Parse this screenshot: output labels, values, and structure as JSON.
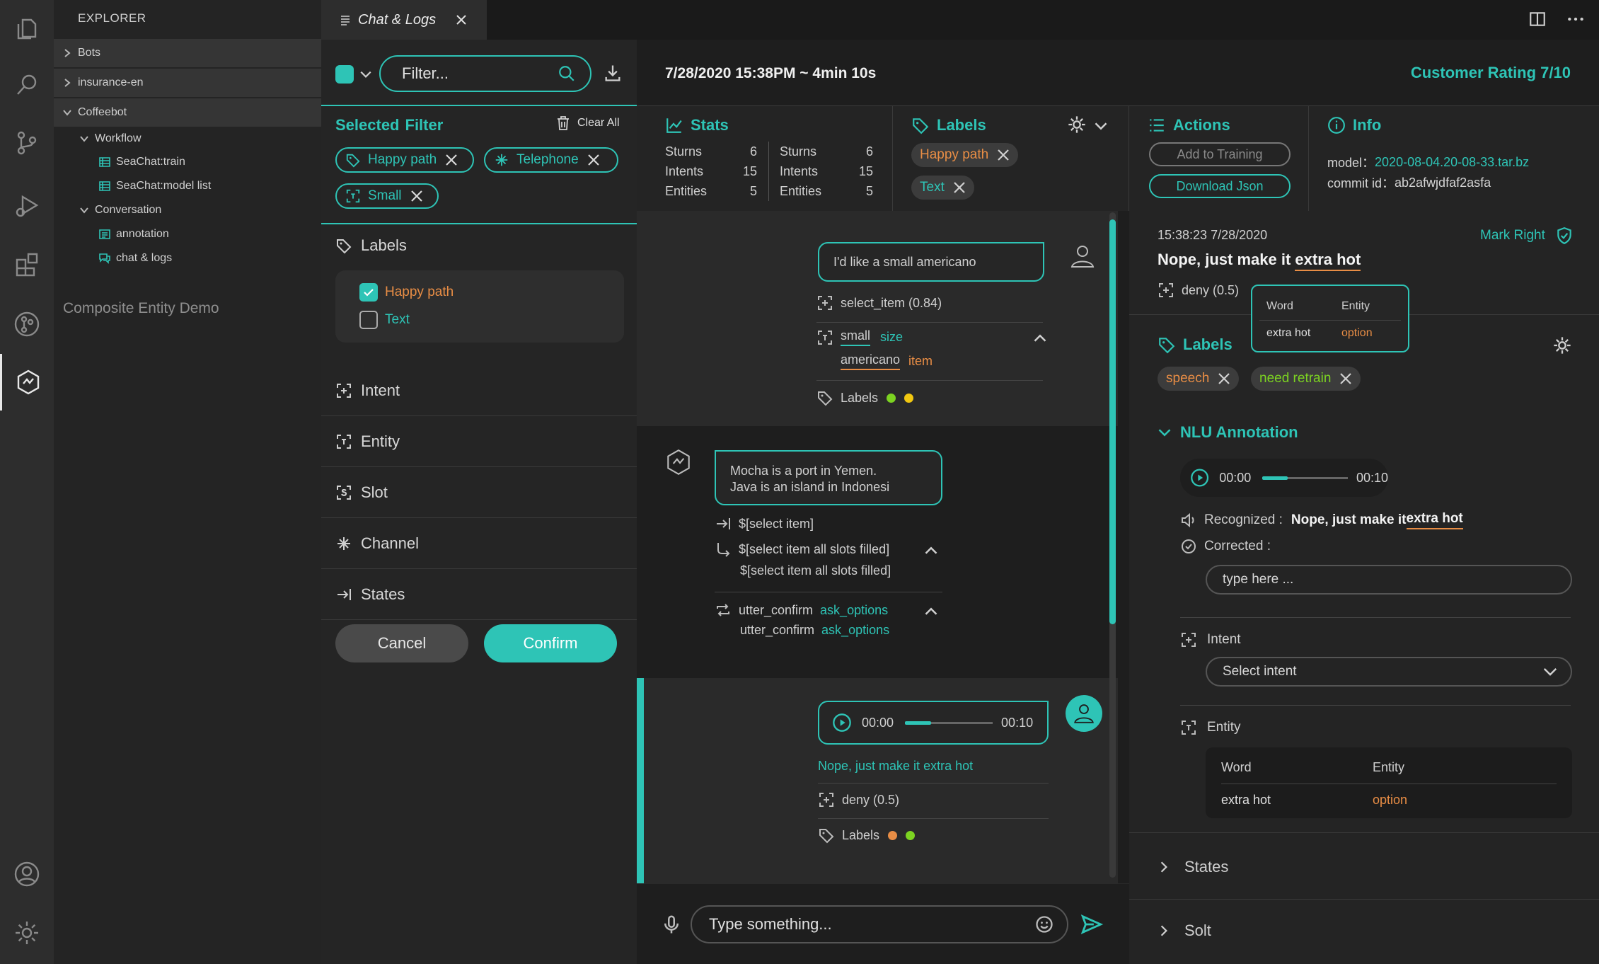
{
  "explorer": {
    "title": "EXPLORER",
    "items": [
      {
        "label": "Bots"
      },
      {
        "label": "insurance-en"
      },
      {
        "label": "Coffeebot"
      },
      {
        "label": "Workflow"
      },
      {
        "label": "SeaChat:train"
      },
      {
        "label": "SeaChat:model list"
      },
      {
        "label": "Conversation"
      },
      {
        "label": "annotation"
      },
      {
        "label": "chat & logs"
      }
    ],
    "footer": "Composite Entity Demo"
  },
  "tab": {
    "label": "Chat & Logs"
  },
  "filter": {
    "search_placeholder": "Filter...",
    "selected_title": "Selected",
    "filter_word": "Filter",
    "clear_all": "Clear All",
    "pills": [
      "Happy path",
      "Telephone",
      "Small"
    ],
    "labels_title": "Labels",
    "checkbox_items": [
      {
        "label": "Happy path",
        "checked": true
      },
      {
        "label": "Text",
        "checked": false
      }
    ],
    "sections": [
      "Intent",
      "Entity",
      "Slot",
      "Channel",
      "States"
    ],
    "cancel": "Cancel",
    "confirm": "Confirm"
  },
  "header": {
    "datetime": "7/28/2020 15:38PM ~ 4min 10s",
    "rating": "Customer Rating 7/10"
  },
  "stats": {
    "title": "Stats",
    "col1": [
      [
        "Sturns",
        "6"
      ],
      [
        "Intents",
        "15"
      ],
      [
        "Entities",
        "5"
      ]
    ],
    "col2": [
      [
        "Sturns",
        "6"
      ],
      [
        "Intents",
        "15"
      ],
      [
        "Entities",
        "5"
      ]
    ]
  },
  "labels_panel": {
    "title": "Labels",
    "chips": [
      "Happy path",
      "Text"
    ]
  },
  "actions": {
    "title": "Actions",
    "add": "Add to Training",
    "download": "Download Json"
  },
  "info": {
    "title": "Info",
    "model_label": "model：",
    "model_value": "2020-08-04.20-08-33.tar.bz",
    "commit_label": "commit id：",
    "commit_value": "ab2afwjdfaf2asfa"
  },
  "chat": {
    "msg1": {
      "text": "I'd like a small americano",
      "intent": "select_item (0.84)",
      "ent1_word": "small",
      "ent1_type": "size",
      "ent2_word": "americano",
      "ent2_type": "item",
      "labels": "Labels",
      "dot_colors": [
        "#7cd321",
        "#f2c811"
      ]
    },
    "msg2": {
      "line1": "Mocha is a port in Yemen.",
      "line2": "Java is an island in Indonesi",
      "action1": "$[select item]",
      "action2": "$[select item all slots filled]",
      "action3": "$[select item all slots filled]",
      "utter1": "utter_confirm",
      "utter1_opt": "ask_options",
      "utter2": "utter_confirm",
      "utter2_opt": "ask_options"
    },
    "msg3": {
      "time_start": "00:00",
      "time_end": "00:10",
      "progress": 0.3,
      "transcript": "Nope, just make it extra hot",
      "intent": "deny (0.5)",
      "labels": "Labels",
      "dot_colors": [
        "#e88d45",
        "#7cd321"
      ]
    },
    "input_placeholder": "Type something..."
  },
  "detail": {
    "timestamp": "15:38:23 7/28/2020",
    "mark_right": "Mark Right",
    "utterance_prefix": "Nope, just make it ",
    "utterance_entity": "extra hot",
    "intent": "deny (0.5)",
    "tooltip": {
      "h1": "Word",
      "h2": "Entity",
      "word": "extra hot",
      "entity": "option"
    },
    "labels_title": "Labels",
    "chips": [
      "speech",
      "need retrain"
    ],
    "nlu_title": "NLU Annotation",
    "audio_start": "00:00",
    "audio_end": "00:10",
    "audio_progress": 0.3,
    "recognized_label": "Recognized :",
    "recognized_prefix": "Nope, just make it ",
    "recognized_entity": "extra hot",
    "corrected_label": "Corrected :",
    "corrected_placeholder": "type here ...",
    "intent_label": "Intent",
    "intent_select": "Select intent",
    "entity_label": "Entity",
    "entity_table": {
      "h1": "Word",
      "h2": "Entity",
      "word": "extra hot",
      "entity": "option"
    },
    "states": "States",
    "solt": "Solt"
  },
  "colors": {
    "accent": "#2ec4b6",
    "orange": "#e88d45",
    "green": "#7cd321"
  }
}
